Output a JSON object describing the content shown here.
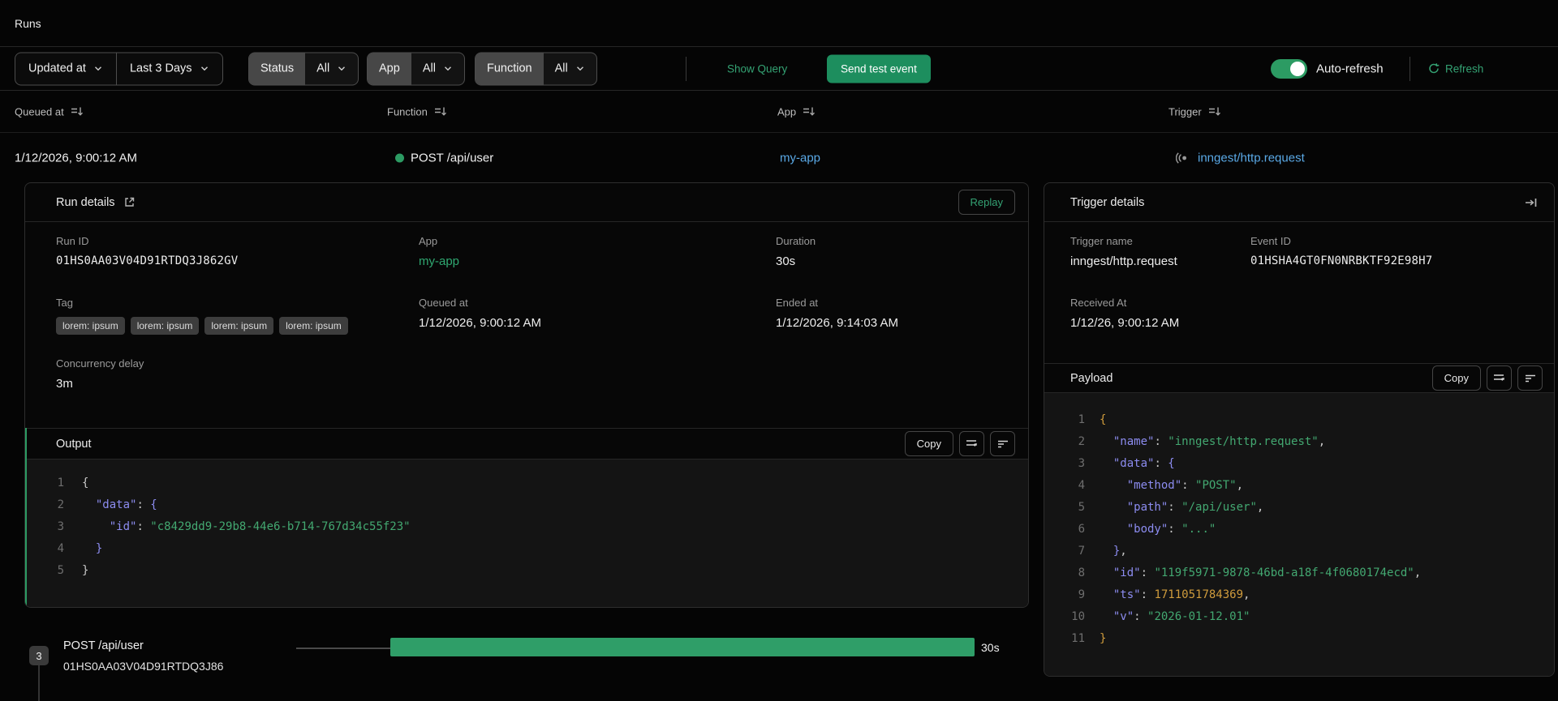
{
  "page": {
    "title": "Runs"
  },
  "filters": {
    "sort_field": "Updated at",
    "time_range": "Last 3 Days",
    "status_label": "Status",
    "status_value": "All",
    "app_label": "App",
    "app_value": "All",
    "function_label": "Function",
    "function_value": "All",
    "show_query": "Show Query",
    "send_test_event": "Send test event",
    "auto_refresh_label": "Auto-refresh",
    "refresh_label": "Refresh"
  },
  "table": {
    "headers": {
      "queued_at": "Queued at",
      "function": "Function",
      "app": "App",
      "trigger": "Trigger"
    },
    "row": {
      "queued_at": "1/12/2026, 9:00:12 AM",
      "function": "POST /api/user",
      "app": "my-app",
      "trigger": "inngest/http.request"
    }
  },
  "run_details": {
    "title": "Run details",
    "replay_label": "Replay",
    "run_id_label": "Run ID",
    "run_id": "01HS0AA03V04D91RTDQ3J862GV",
    "app_label": "App",
    "app": "my-app",
    "duration_label": "Duration",
    "duration": "30s",
    "tag_label": "Tag",
    "tags": [
      "lorem: ipsum",
      "lorem: ipsum",
      "lorem: ipsum",
      "lorem: ipsum"
    ],
    "queued_at_label": "Queued at",
    "queued_at": "1/12/2026, 9:00:12 AM",
    "ended_at_label": "Ended at",
    "ended_at": "1/12/2026, 9:14:03 AM",
    "concurrency_label": "Concurrency delay",
    "concurrency": "3m",
    "output": {
      "title": "Output",
      "copy_label": "Copy",
      "lines": [
        [
          {
            "t": "{",
            "c": "p"
          }
        ],
        [
          {
            "t": "  ",
            "c": "p"
          },
          {
            "t": "\"data\"",
            "c": "k"
          },
          {
            "t": ": ",
            "c": "p"
          },
          {
            "t": "{",
            "c": "b2"
          }
        ],
        [
          {
            "t": "    ",
            "c": "p"
          },
          {
            "t": "\"id\"",
            "c": "k"
          },
          {
            "t": ": ",
            "c": "p"
          },
          {
            "t": "\"c8429dd9-29b8-44e6-b714-767d34c55f23\"",
            "c": "s"
          }
        ],
        [
          {
            "t": "  ",
            "c": "p"
          },
          {
            "t": "}",
            "c": "b2"
          }
        ],
        [
          {
            "t": "}",
            "c": "p"
          }
        ]
      ]
    }
  },
  "trigger_details": {
    "title": "Trigger details",
    "trigger_name_label": "Trigger name",
    "trigger_name": "inngest/http.request",
    "event_id_label": "Event ID",
    "event_id": "01HSHA4GT0FN0NRBKTF92E98H7",
    "received_at_label": "Received At",
    "received_at": "1/12/26, 9:00:12 AM",
    "payload": {
      "title": "Payload",
      "copy_label": "Copy",
      "lines": [
        [
          {
            "t": "{",
            "c": "b1"
          }
        ],
        [
          {
            "t": "  ",
            "c": "p"
          },
          {
            "t": "\"name\"",
            "c": "k"
          },
          {
            "t": ": ",
            "c": "p"
          },
          {
            "t": "\"inngest/http.request\"",
            "c": "s"
          },
          {
            "t": ",",
            "c": "p"
          }
        ],
        [
          {
            "t": "  ",
            "c": "p"
          },
          {
            "t": "\"data\"",
            "c": "k"
          },
          {
            "t": ": ",
            "c": "p"
          },
          {
            "t": "{",
            "c": "b2"
          }
        ],
        [
          {
            "t": "    ",
            "c": "p"
          },
          {
            "t": "\"method\"",
            "c": "k"
          },
          {
            "t": ": ",
            "c": "p"
          },
          {
            "t": "\"POST\"",
            "c": "s"
          },
          {
            "t": ",",
            "c": "p"
          }
        ],
        [
          {
            "t": "    ",
            "c": "p"
          },
          {
            "t": "\"path\"",
            "c": "k"
          },
          {
            "t": ": ",
            "c": "p"
          },
          {
            "t": "\"/api/user\"",
            "c": "s"
          },
          {
            "t": ",",
            "c": "p"
          }
        ],
        [
          {
            "t": "    ",
            "c": "p"
          },
          {
            "t": "\"body\"",
            "c": "k"
          },
          {
            "t": ": ",
            "c": "p"
          },
          {
            "t": "\"...\"",
            "c": "s"
          }
        ],
        [
          {
            "t": "  ",
            "c": "p"
          },
          {
            "t": "}",
            "c": "b2"
          },
          {
            "t": ",",
            "c": "p"
          }
        ],
        [
          {
            "t": "  ",
            "c": "p"
          },
          {
            "t": "\"id\"",
            "c": "k"
          },
          {
            "t": ": ",
            "c": "p"
          },
          {
            "t": "\"119f5971-9878-46bd-a18f-4f0680174ecd\"",
            "c": "s"
          },
          {
            "t": ",",
            "c": "p"
          }
        ],
        [
          {
            "t": "  ",
            "c": "p"
          },
          {
            "t": "\"ts\"",
            "c": "k"
          },
          {
            "t": ": ",
            "c": "p"
          },
          {
            "t": "1711051784369",
            "c": "n"
          },
          {
            "t": ",",
            "c": "p"
          }
        ],
        [
          {
            "t": "  ",
            "c": "p"
          },
          {
            "t": "\"v\"",
            "c": "k"
          },
          {
            "t": ": ",
            "c": "p"
          },
          {
            "t": "\"2026-01-12.01\"",
            "c": "s"
          }
        ],
        [
          {
            "t": "}",
            "c": "b1"
          }
        ]
      ]
    }
  },
  "timeline": {
    "badge": "3",
    "function": "POST /api/user",
    "run_id": "01HS0AA03V04D91RTDQ3J86",
    "duration": "30s"
  },
  "colors": {
    "accent_green": "#2c9b63",
    "link_blue": "#5aa9e6",
    "code_key": "#8c8cf0",
    "code_string": "#43a871",
    "code_number": "#cf9b3c"
  }
}
